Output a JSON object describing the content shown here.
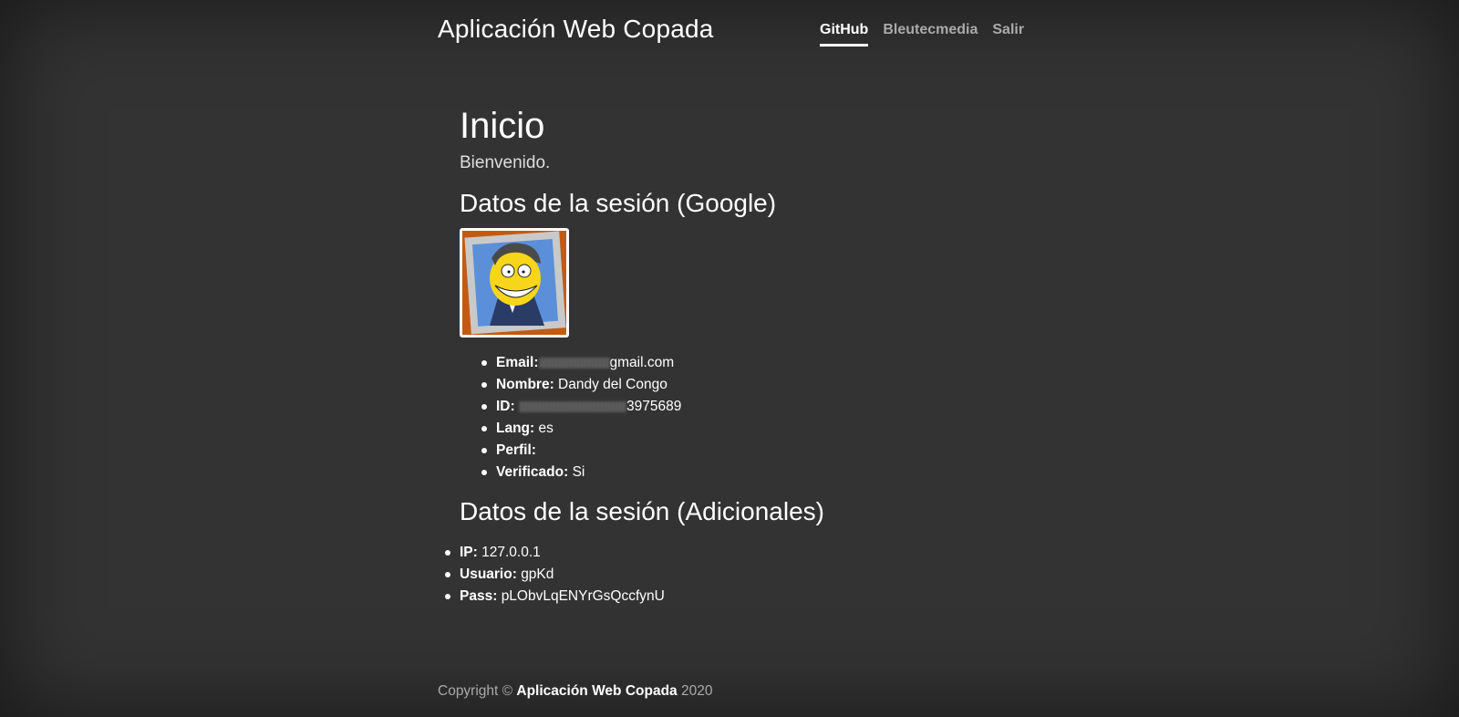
{
  "header": {
    "brand": "Aplicación Web Copada",
    "nav": [
      "GitHub",
      "Bleutecmedia",
      "Salir"
    ]
  },
  "main": {
    "title": "Inicio",
    "welcome": "Bienvenido.",
    "google_heading": "Datos de la sesión (Google)",
    "google": [
      {
        "label": "Email:",
        "value": "gmail.com"
      },
      {
        "label": "Nombre:",
        "value": "Dandy del Congo"
      },
      {
        "label": "ID:",
        "value": "3975689"
      },
      {
        "label": "Lang:",
        "value": "es"
      },
      {
        "label": "Perfil:",
        "value": ""
      },
      {
        "label": "Verificado:",
        "value": "Si"
      }
    ],
    "extra_heading": "Datos de la sesión (Adicionales)",
    "extra": [
      {
        "label": "IP:",
        "value": "127.0.0.1"
      },
      {
        "label": "Usuario:",
        "value": "gpKd"
      },
      {
        "label": "Pass:",
        "value": "pLObvLqENYrGsQccfynU"
      }
    ]
  },
  "footer": {
    "prefix": "Copyright ©",
    "brand": "Aplicación Web Copada",
    "year": "2020"
  }
}
